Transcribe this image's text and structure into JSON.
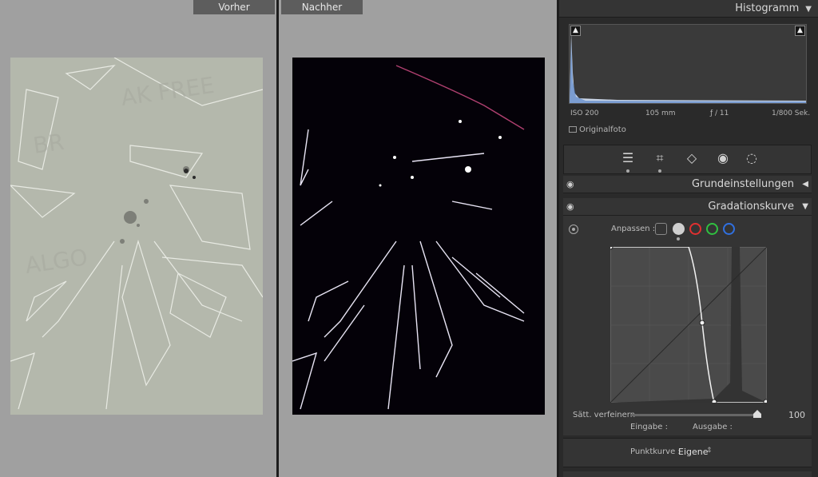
{
  "compare": {
    "before_label": "Vorher",
    "after_label": "Nachher"
  },
  "histogram": {
    "title": "Histogramm",
    "iso": "ISO 200",
    "focal": "105 mm",
    "aperture": "ƒ / 11",
    "shutter": "1/800 Sek.",
    "original_label": "Originalfoto"
  },
  "sections": {
    "basic": "Grundeinstellungen",
    "tone_curve": "Gradationskurve"
  },
  "tone_curve": {
    "adjust_label": "Anpassen :",
    "channels": [
      {
        "name": "rgb",
        "color": "#cfcfcf"
      },
      {
        "name": "red",
        "color": "#e03030"
      },
      {
        "name": "green",
        "color": "#30c040"
      },
      {
        "name": "blue",
        "color": "#3070e0"
      }
    ],
    "saturation_label": "Sätt. verfeinern",
    "saturation_value": "100",
    "input_label": "Eingabe :",
    "output_label": "Ausgabe :",
    "point_curve_label": "Punktkurve :",
    "point_curve_value": "Eigene"
  },
  "colors": {
    "panel_bg": "#343434",
    "compare_bg": "#a0a0a0"
  }
}
